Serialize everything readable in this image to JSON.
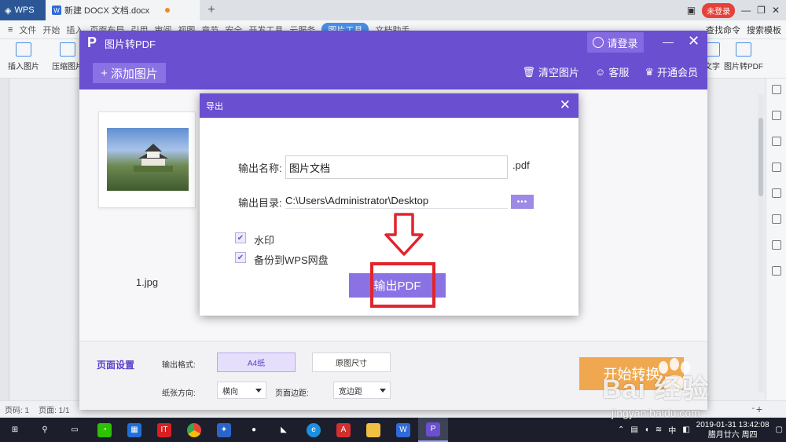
{
  "titlebar": {
    "app_tab": "WPS",
    "doc_tab": "新建 DOCX 文档.docx",
    "new_tab": "+",
    "login_badge": "未登录"
  },
  "menubar": {
    "file": "文件",
    "items": [
      "开始",
      "插入",
      "页面布局",
      "引用",
      "审阅",
      "视图",
      "章节",
      "安全",
      "开发工具",
      "云服务"
    ],
    "active": "图片工具",
    "extra": "文档助手",
    "right": [
      "查找命令",
      "搜索模板"
    ]
  },
  "ribbon": {
    "left": [
      "插入图片",
      "压缩图片"
    ],
    "right": [
      "文字",
      "图片转PDF"
    ]
  },
  "pdf_window": {
    "title": "图片转PDF",
    "login": "请登录",
    "add_image": "添加图片",
    "actions": [
      "清空图片",
      "客服",
      "开通会员"
    ],
    "thumbnail_name": "1.jpg",
    "footer": {
      "page_settings": "页面设置",
      "output_format_label": "输出格式:",
      "format_a4": "A4纸",
      "format_original": "原图尺寸",
      "orientation_label": "纸张方向:",
      "orientation_value": "横向",
      "margin_label": "页面边距:",
      "margin_value": "宽边距",
      "start": "开始转换"
    }
  },
  "export_dialog": {
    "title": "导出",
    "name_label": "输出名称:",
    "name_value": "图片文档",
    "suffix": ".pdf",
    "dir_label": "输出目录:",
    "dir_value": "C:\\Users\\Administrator\\Desktop",
    "browse": "•••",
    "watermark_label": "水印",
    "backup_label": "备份到WPS网盘",
    "export_button": "输出PDF"
  },
  "statusbar": {
    "pages": "页码: 1",
    "page_of": "页面: 1/1",
    "zoom": "-"
  },
  "taskbar": {
    "ime": "中",
    "date": "2019-01-31",
    "time": "13:42:08",
    "lunar": "腊月廿六 周四"
  },
  "watermark": {
    "brand": "Bai  经验",
    "url": "jingyan.baidu.com"
  }
}
